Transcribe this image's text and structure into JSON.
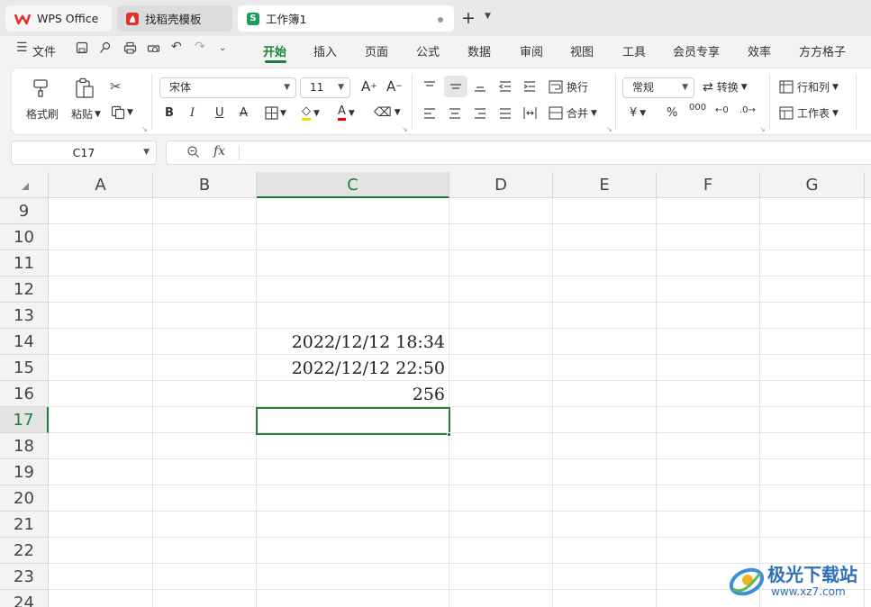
{
  "tabs": [
    {
      "label": "WPS Office",
      "icon": "wps-logo-icon"
    },
    {
      "label": "找稻壳模板",
      "icon": "docer-icon"
    },
    {
      "label": "工作簿1",
      "icon": "spreadsheet-s-icon",
      "icon_text": "S"
    }
  ],
  "new_tab": "+",
  "menu": {
    "file_label": "文件",
    "items": [
      "开始",
      "插入",
      "页面",
      "公式",
      "数据",
      "审阅",
      "视图",
      "工具",
      "会员专享",
      "效率",
      "方方格子"
    ],
    "active": "开始"
  },
  "ribbon": {
    "format_painter": "格式刷",
    "paste": "粘贴",
    "font_name": "宋体",
    "font_size": "11",
    "wrap_text": "换行",
    "merge": "合并",
    "number_format": "常规",
    "convert": "转换",
    "rows_cols": "行和列",
    "worksheet": "工作表"
  },
  "formula_bar": {
    "name_box": "C17",
    "fx_label": "fx",
    "content": ""
  },
  "sheet": {
    "columns": [
      "A",
      "B",
      "C",
      "D",
      "E",
      "F",
      "G"
    ],
    "selected_column": "C",
    "rows": [
      "9",
      "10",
      "11",
      "12",
      "13",
      "14",
      "15",
      "16",
      "17",
      "18",
      "19",
      "20",
      "21",
      "22",
      "23",
      "24"
    ],
    "selected_row": "17",
    "cells": {
      "C14": "2022/12/12 18:34",
      "C15": "2022/12/12 22:50",
      "C16": "256"
    }
  },
  "watermark": {
    "title": "极光下载站",
    "url": "www.xz7.com"
  },
  "colors": {
    "accent": "#1a7f3c",
    "wps_red": "#e0312b",
    "spreadsheet_green": "#1a9c5a"
  }
}
